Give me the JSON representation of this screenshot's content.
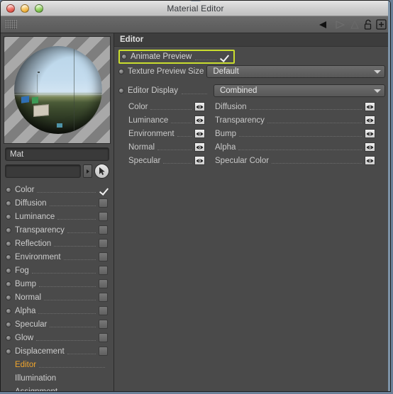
{
  "window": {
    "title": "Material Editor",
    "traffic_lights": [
      "close-button",
      "minimize-button",
      "zoom-button"
    ]
  },
  "toolbar": {
    "grip": "grip-handle",
    "icons": [
      "play-back-icon",
      "play-forward-icon",
      "step-icon",
      "lock-icon",
      "add-icon"
    ]
  },
  "sidebar": {
    "preview": {
      "name": "material-preview-sphere"
    },
    "name_field": {
      "value": "Mat",
      "placeholder": ""
    },
    "search_field": {
      "value": "",
      "placeholder": ""
    },
    "channels": [
      {
        "label": "Color",
        "checked": true
      },
      {
        "label": "Diffusion",
        "checked": false
      },
      {
        "label": "Luminance",
        "checked": false
      },
      {
        "label": "Transparency",
        "checked": false
      },
      {
        "label": "Reflection",
        "checked": false
      },
      {
        "label": "Environment",
        "checked": false
      },
      {
        "label": "Fog",
        "checked": false
      },
      {
        "label": "Bump",
        "checked": false
      },
      {
        "label": "Normal",
        "checked": false
      },
      {
        "label": "Alpha",
        "checked": false
      },
      {
        "label": "Specular",
        "checked": false
      },
      {
        "label": "Glow",
        "checked": false
      },
      {
        "label": "Displacement",
        "checked": false
      }
    ],
    "nav_items": [
      {
        "label": "Editor",
        "selected": true
      },
      {
        "label": "Illumination",
        "selected": false
      },
      {
        "label": "Assignment",
        "selected": false
      }
    ]
  },
  "editor_panel": {
    "header": "Editor",
    "animate_preview": {
      "label": "Animate Preview",
      "checked": true,
      "highlighted": true,
      "highlight_color": "#cadd2e"
    },
    "texture_preview_size": {
      "label": "Texture Preview Size",
      "value": "Default"
    },
    "editor_display": {
      "label": "Editor Display",
      "value": "Combined"
    },
    "display_channels": [
      {
        "left": "Color",
        "right": "Diffusion"
      },
      {
        "left": "Luminance",
        "right": "Transparency"
      },
      {
        "left": "Environment",
        "right": "Bump"
      },
      {
        "left": "Normal",
        "right": "Alpha"
      },
      {
        "left": "Specular",
        "right": "Specular Color"
      }
    ]
  },
  "colors": {
    "panel_bg": "#4a4a4a",
    "header_bg": "#3d3d3d",
    "accent_selected": "#f0a52c",
    "highlight": "#cadd2e"
  }
}
